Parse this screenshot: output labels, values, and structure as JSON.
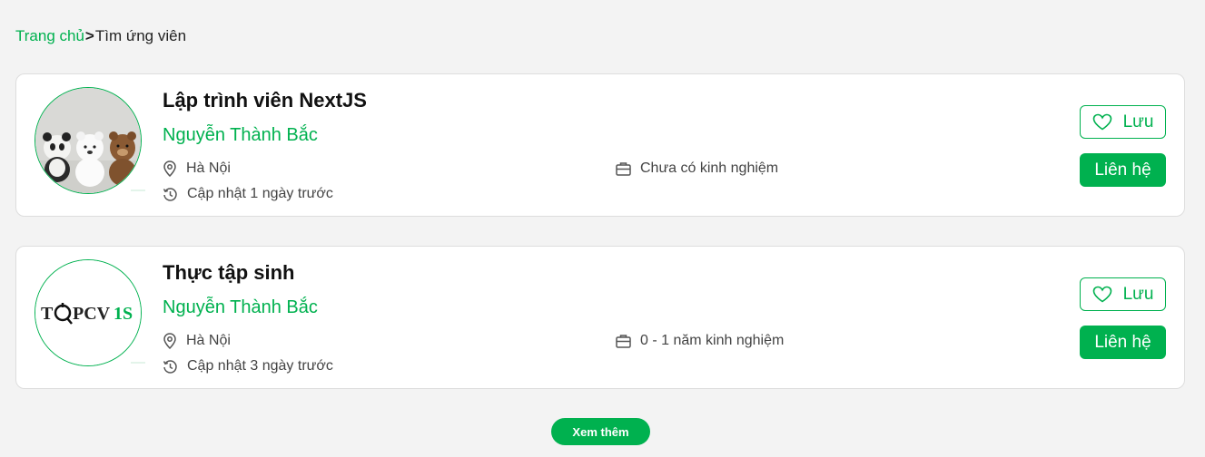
{
  "breadcrumb": {
    "home": "Trang chủ",
    "separator": ">",
    "current": "Tìm ứng viên"
  },
  "candidates": [
    {
      "title": "Lập trình viên NextJS",
      "name": "Nguyễn Thành Bắc",
      "location": "Hà Nội",
      "updated": "Cập nhật 1 ngày trước",
      "experience": "Chưa có kinh nghiệm",
      "save_label": "Lưu",
      "contact_label": "Liên hệ",
      "avatar": "bear-plush-photo"
    },
    {
      "title": "Thực tập sinh",
      "name": "Nguyễn Thành Bắc",
      "location": "Hà Nội",
      "updated": "Cập nhật 3 ngày trước",
      "experience": "0 - 1 năm kinh nghiệm",
      "save_label": "Lưu",
      "contact_label": "Liên hệ",
      "avatar": "logo",
      "avatar_logo_text": "TOPCV1S"
    }
  ],
  "more_button": "Xem thêm",
  "colors": {
    "accent": "#00b14f",
    "background": "#f3f3f3",
    "card_border": "#dddddd"
  },
  "icons": [
    "location-icon",
    "history-icon",
    "briefcase-icon",
    "heart-icon"
  ]
}
